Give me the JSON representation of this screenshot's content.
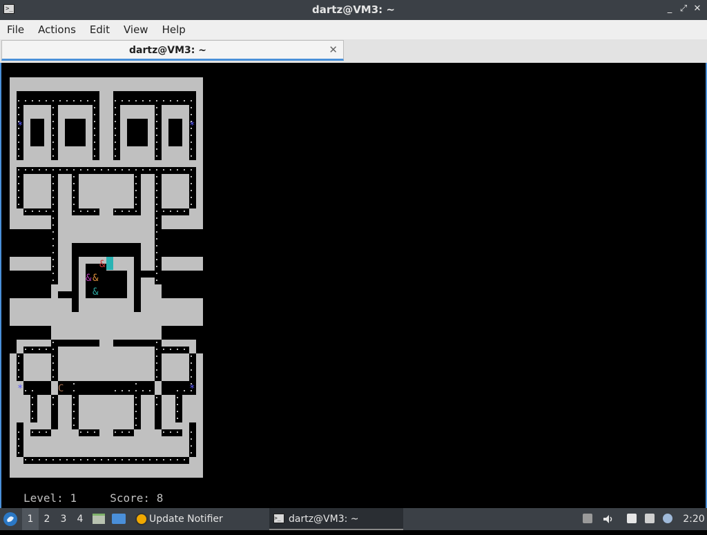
{
  "window": {
    "title": "dartz@VM3: ~",
    "controls": [
      "_",
      "⤢",
      "✕"
    ]
  },
  "menubar": {
    "items": [
      "File",
      "Actions",
      "Edit",
      "View",
      "Help"
    ]
  },
  "tab": {
    "label": "dartz@VM3: ~",
    "close": "✕"
  },
  "game": {
    "level_label": "Level:",
    "level": "1",
    "score_label": "Score:",
    "score": "8",
    "player_glyph": "C",
    "ghost_glyph": "&",
    "power_pellet_glyph": "*",
    "colors": {
      "wall": "#c0c0c0",
      "pellet": "#c0c0c0",
      "power_pellet": "#5b5bff",
      "player": "#a06a4a",
      "ghost_red": "#cc3b3b",
      "ghost_magenta": "#b23bb2",
      "ghost_orange": "#d98c3b",
      "ghost_teal": "#2aa59f",
      "cursor": "#2ab3b3"
    }
  },
  "taskbar": {
    "workspaces": [
      "1",
      "2",
      "3",
      "4"
    ],
    "tasks": [
      {
        "label": "Update Notifier",
        "icon": "update-notifier-icon"
      },
      {
        "label": "dartz@VM3: ~",
        "icon": "terminal-icon"
      }
    ],
    "clock": "2:20"
  }
}
